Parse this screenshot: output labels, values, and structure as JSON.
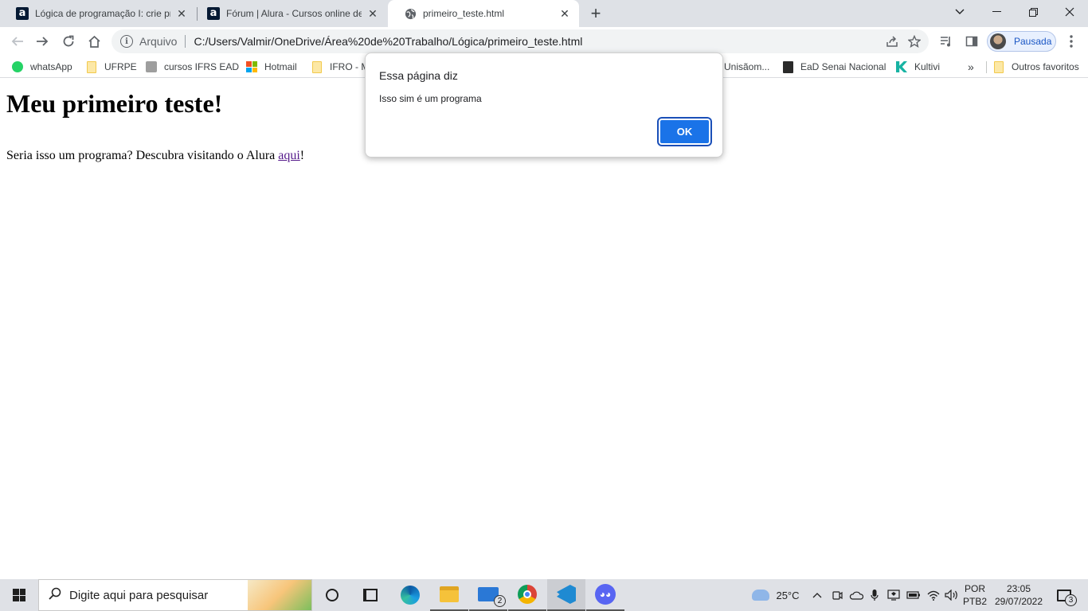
{
  "browser": {
    "tabs": [
      {
        "title": "Lógica de programação I: crie pro",
        "favicon": "alura-icon",
        "active": false
      },
      {
        "title": "Fórum | Alura - Cursos online de",
        "favicon": "alura-icon",
        "active": false
      },
      {
        "title": "primeiro_teste.html",
        "favicon": "globe-icon",
        "active": true
      }
    ],
    "favicon_letter": "a",
    "omnibox": {
      "scheme_label": "Arquivo",
      "url": "C:/Users/Valmir/OneDrive/Área%20de%20Trabalho/Lógica/primeiro_teste.html"
    },
    "profile_label": "Pausada",
    "bookmarks": [
      {
        "label": "whatsApp",
        "icon": "whatsapp-icon"
      },
      {
        "label": "UFRPE",
        "icon": "folder-icon"
      },
      {
        "label": "cursos IFRS EAD",
        "icon": "ifrs-icon"
      },
      {
        "label": "Hotmail",
        "icon": "microsoft-icon"
      },
      {
        "label": "IFRO - M",
        "icon": "folder-icon"
      },
      {
        "label": "Unisãom...",
        "icon": "unisaom-icon"
      },
      {
        "label": "EaD Senai Nacional",
        "icon": "senai-icon"
      },
      {
        "label": "Kultivi",
        "icon": "kultivi-icon"
      }
    ],
    "bookmarks_overflow": "»",
    "other_bookmarks": "Outros favoritos"
  },
  "page": {
    "heading": "Meu primeiro teste!",
    "paragraph_before": "Seria isso um programa? Descubra visitando o Alura ",
    "link_text": "aqui",
    "paragraph_after": "!"
  },
  "dialog": {
    "title": "Essa página diz",
    "message": "Isso sim é um programa",
    "ok_label": "OK"
  },
  "taskbar": {
    "search_placeholder": "Digite aqui para pesquisar",
    "apps": [
      "cortana",
      "task-view",
      "edge",
      "file-explorer",
      "mail",
      "chrome",
      "vscode",
      "discord"
    ],
    "mail_badge": "2",
    "weather": "25°C",
    "lang_top": "POR",
    "lang_bottom": "PTB2",
    "time": "23:05",
    "date": "29/07/2022",
    "notifications_count": "3"
  },
  "colors": {
    "tabstrip": "#dee1e6",
    "accent": "#1a73e8",
    "link_visited": "#551a8b"
  }
}
